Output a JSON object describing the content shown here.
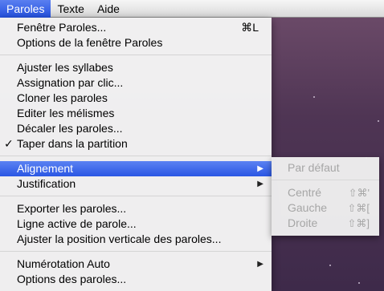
{
  "menubar": {
    "items": [
      {
        "label": "Paroles"
      },
      {
        "label": "Texte"
      },
      {
        "label": "Aide"
      }
    ]
  },
  "menu": {
    "group1": [
      {
        "label": "Fenêtre Paroles...",
        "shortcut": "⌘L"
      },
      {
        "label": "Options de la fenêtre Paroles"
      }
    ],
    "group2": [
      {
        "label": "Ajuster les syllabes"
      },
      {
        "label": "Assignation par clic..."
      },
      {
        "label": "Cloner les paroles"
      },
      {
        "label": "Editer les mélismes"
      },
      {
        "label": "Décaler les paroles..."
      },
      {
        "label": "Taper dans la partition",
        "check": "✓"
      }
    ],
    "group3": [
      {
        "label": "Alignement",
        "arrow": "▶"
      },
      {
        "label": "Justification",
        "arrow": "▶"
      }
    ],
    "group4": [
      {
        "label": "Exporter les paroles..."
      },
      {
        "label": "Ligne active de parole..."
      },
      {
        "label": "Ajuster la position verticale des paroles..."
      }
    ],
    "group5": [
      {
        "label": "Numérotation Auto",
        "arrow": "▶"
      },
      {
        "label": "Options des paroles..."
      }
    ]
  },
  "submenu": {
    "default_label": "Par défaut",
    "items": [
      {
        "label": "Centré",
        "shortcut": "⇧⌘'"
      },
      {
        "label": "Gauche",
        "shortcut": "⇧⌘["
      },
      {
        "label": "Droite",
        "shortcut": "⇧⌘]"
      }
    ]
  }
}
